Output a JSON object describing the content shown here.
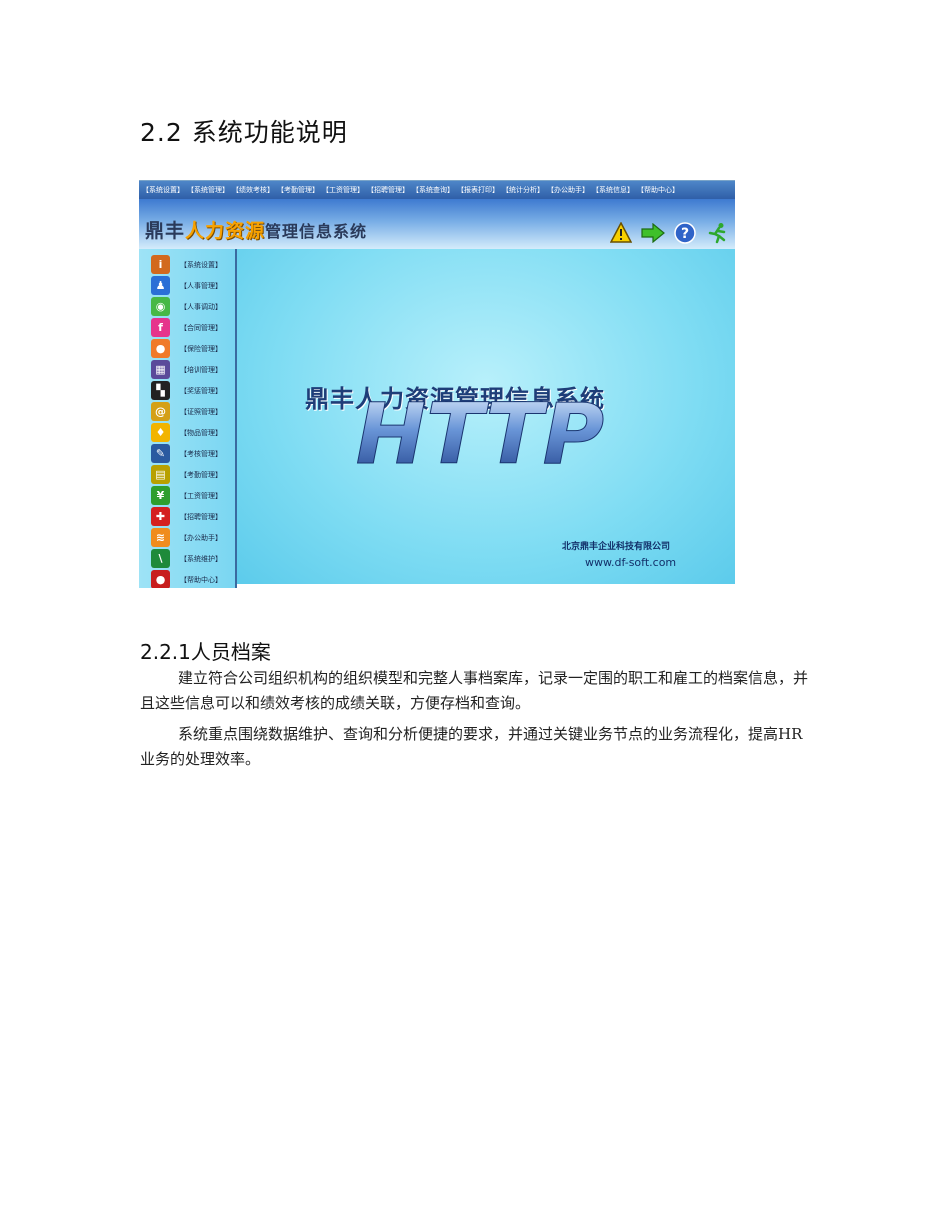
{
  "section_heading": "2.2 系统功能说明",
  "subsection_heading": "2.2.1人员档案",
  "paragraphs": [
    "建立符合公司组织机构的组织模型和完整人事档案库，记录一定围的职工和雇工的档案信息，并且这些信息可以和绩效考核的成绩关联，方便存档和查询。",
    "系统重点围绕数据维护、查询和分析便捷的要求，并通过关键业务节点的业务流程化，提高HR业务的处理效率。"
  ],
  "screenshot": {
    "menu_items": [
      "【系统设置】",
      "【系统管理】",
      "【绩效考核】",
      "【考勤管理】",
      "【工资管理】",
      "【招聘管理】",
      "【系统查询】",
      "【报表打印】",
      "【统计分析】",
      "【办公助手】",
      "【系统信息】",
      "【帮助中心】"
    ],
    "brand": {
      "prefix": "鼎丰",
      "highlight": "人力资源",
      "suffix": "管理信息系统"
    },
    "toolbar_icons": [
      "warning-icon",
      "forward-arrow-icon",
      "help-icon",
      "exit-runner-icon"
    ],
    "sidebar_items": [
      {
        "label": "【系统设置】",
        "icon": "info-icon",
        "color": "#d2691e",
        "glyph": "i"
      },
      {
        "label": "【人事管理】",
        "icon": "people-icon",
        "color": "#2a6fd6",
        "glyph": "♟"
      },
      {
        "label": "【人事调动】",
        "icon": "chat-icon",
        "color": "#47b846",
        "glyph": "◉"
      },
      {
        "label": "【合同管理】",
        "icon": "contract-icon",
        "color": "#e6348c",
        "glyph": "f"
      },
      {
        "label": "【保险管理】",
        "icon": "insurance-icon",
        "color": "#f07a2a",
        "glyph": "●"
      },
      {
        "label": "【培训管理】",
        "icon": "training-icon",
        "color": "#5a4a9a",
        "glyph": "▦"
      },
      {
        "label": "【奖惩管理】",
        "icon": "reward-icon",
        "color": "#222222",
        "glyph": "▚"
      },
      {
        "label": "【证照管理】",
        "icon": "at-icon",
        "color": "#d4a017",
        "glyph": "@"
      },
      {
        "label": "【物品管理】",
        "icon": "bulb-icon",
        "color": "#f2b400",
        "glyph": "♦"
      },
      {
        "label": "【考核管理】",
        "icon": "pencil-icon",
        "color": "#2a5aa0",
        "glyph": "✎"
      },
      {
        "label": "【考勤管理】",
        "icon": "calendar-icon",
        "color": "#b8a000",
        "glyph": "▤"
      },
      {
        "label": "【工资管理】",
        "icon": "yen-icon",
        "color": "#2e9e2e",
        "glyph": "¥"
      },
      {
        "label": "【招聘管理】",
        "icon": "cross-icon",
        "color": "#d42020",
        "glyph": "✚"
      },
      {
        "label": "【办公助手】",
        "icon": "rss-icon",
        "color": "#f08c1e",
        "glyph": "≋"
      },
      {
        "label": "【系统维护】",
        "icon": "tool-icon",
        "color": "#1e8a3a",
        "glyph": "\\"
      },
      {
        "label": "【帮助中心】",
        "icon": "help-bag-icon",
        "color": "#c81e1e",
        "glyph": "●"
      }
    ],
    "center_title": "鼎丰人力资源管理信息系统",
    "center_logo_text": "HTTP",
    "company_name": "北京鼎丰企业科技有限公司",
    "website": "www.df-soft.com",
    "colors": {
      "background": "#6fd3f0",
      "brand_highlight": "#f7a100",
      "menubar": "#2f5fa8"
    }
  }
}
